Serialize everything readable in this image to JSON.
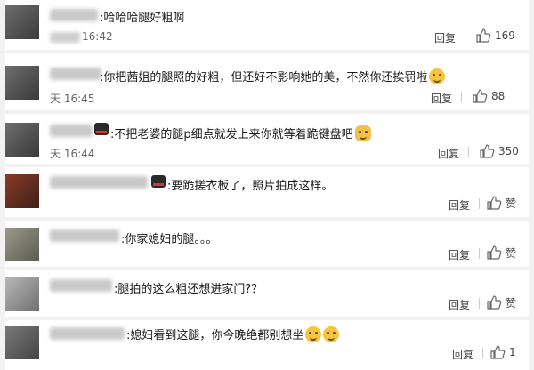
{
  "comments": [
    {
      "text": "哈哈哈腿好粗啊",
      "time": "16:42",
      "reply": "回复",
      "likes": "169"
    },
    {
      "text": "你把茜姐的腿照的好粗，但还好不影响她的美，不然你还挨罚啦",
      "time": "天 16:45",
      "reply": "回复",
      "likes": "88"
    },
    {
      "text": "不把老婆的腿p细点就发上来你就等着跪键盘吧",
      "time": "天 16:44",
      "reply": "回复",
      "likes": "350"
    },
    {
      "text": "要跪搓衣板了，照片拍成这样。",
      "time": "",
      "reply": "回复",
      "likes": "赞"
    },
    {
      "text": "你家媳妇的腿。。。",
      "time": "",
      "reply": "回复",
      "likes": "赞"
    },
    {
      "text": "腿拍的这么粗还想进家门?？",
      "time": "",
      "reply": "回复",
      "likes": "赞"
    },
    {
      "text": "媳妇看到这腿，你今晚绝都别想坐",
      "time": "",
      "reply": "回复",
      "likes": "1"
    }
  ],
  "icons": {
    "thumb": "thumbs-up-icon",
    "emoji": "laughing-emoji-icon",
    "badge": "member-badge-icon"
  },
  "colors": {
    "background": "#f2f2f2",
    "card": "#ffffff",
    "text": "#1a1a1a",
    "meta": "#666666"
  }
}
